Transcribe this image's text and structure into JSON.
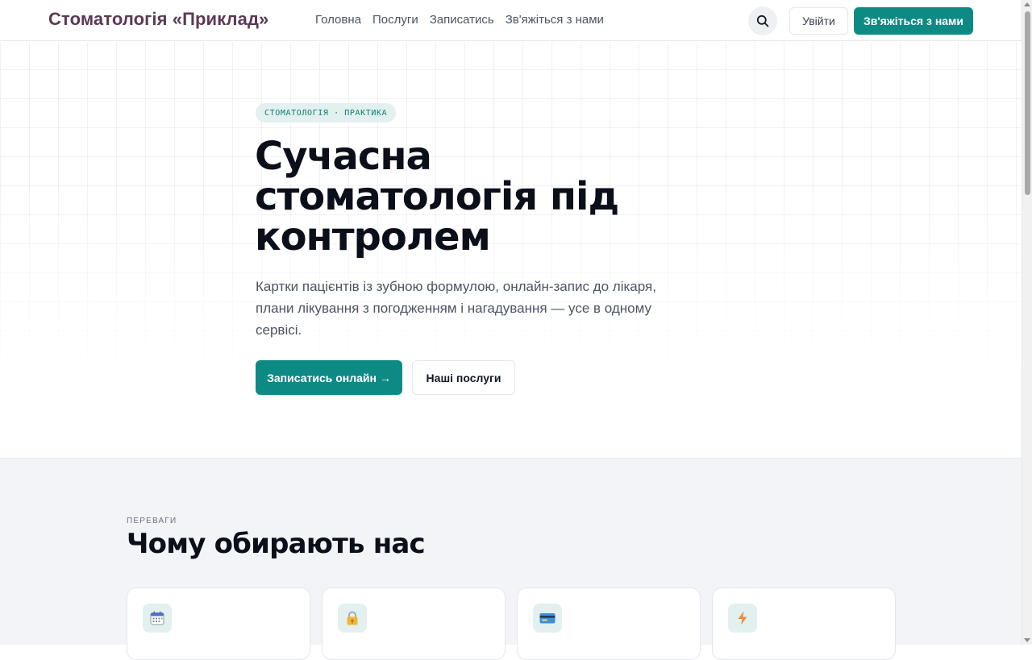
{
  "header": {
    "brand": "Стоматологія «Приклад»",
    "nav": [
      "Головна",
      "Послуги",
      "Записатись",
      "Зв'яжіться з нами"
    ],
    "search_icon": "search-icon",
    "login_label": "Увійти",
    "contact_label": "Зв'яжіться з нами"
  },
  "hero": {
    "pill": "СТОМАТОЛОГІЯ · ПРАКТИКА",
    "title": "Сучасна стоматологія під контролем",
    "description": "Картки пацієнтів із зубною формулою, онлайн-запис до лікаря, плани лікування з погодженням і нагадування — усе в одному сервісі.",
    "primary_cta": "Записатись онлайн →",
    "secondary_cta": "Наші послуги"
  },
  "benefits": {
    "eyebrow": "ПЕРЕВАГИ",
    "title": "Чому обирають нас",
    "cards": [
      {
        "icon": "calendar-icon"
      },
      {
        "icon": "lock-icon"
      },
      {
        "icon": "credit-card-icon"
      },
      {
        "icon": "lightning-icon"
      }
    ]
  },
  "colors": {
    "accent": "#0e8a84",
    "brand": "#5b3a55",
    "pill_bg": "#e2f1ef",
    "section_bg": "#f3f4f7"
  }
}
